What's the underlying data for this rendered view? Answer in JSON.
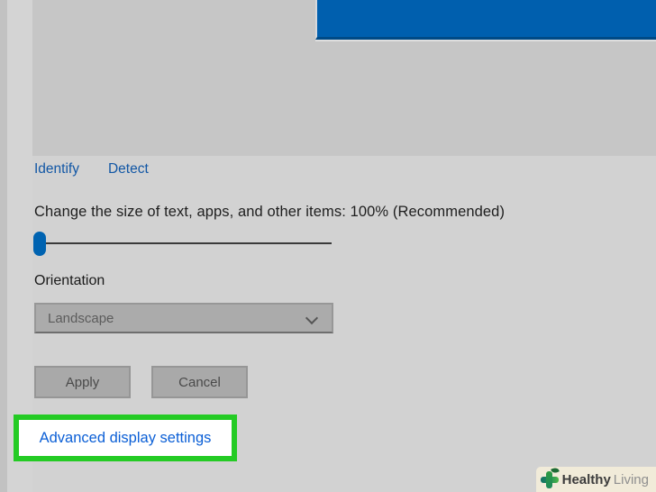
{
  "display_settings": {
    "monitor_preview": {
      "selected_monitor_color": "#005fae"
    },
    "identify_link": "Identify",
    "detect_link": "Detect",
    "scaling": {
      "label": "Change the size of text, apps, and other items: 100% (Recommended)",
      "slider_value_percent": 0
    },
    "orientation": {
      "label": "Orientation",
      "selected_option": "Landscape",
      "dropdown_icon": "chevron-down-icon"
    },
    "apply_button": "Apply",
    "cancel_button": "Cancel",
    "advanced_link": "Advanced display settings"
  },
  "annotation": {
    "highlight_color": "#24cb24"
  },
  "watermark": {
    "brand_bold": "Healthy",
    "brand_light": "Living",
    "logo_icon": "green-cross-leaf-icon"
  },
  "colors": {
    "accent_blue": "#005fae",
    "slider_thumb_blue": "#0063b1",
    "link_blue": "#1257a5",
    "advanced_link_blue": "#0b5fd6",
    "page_background": "#d2d2d2",
    "monitor_preview_gray": "#c6c6c6",
    "control_gray": "#ababab",
    "watermark_background": "#f1ebd9"
  }
}
